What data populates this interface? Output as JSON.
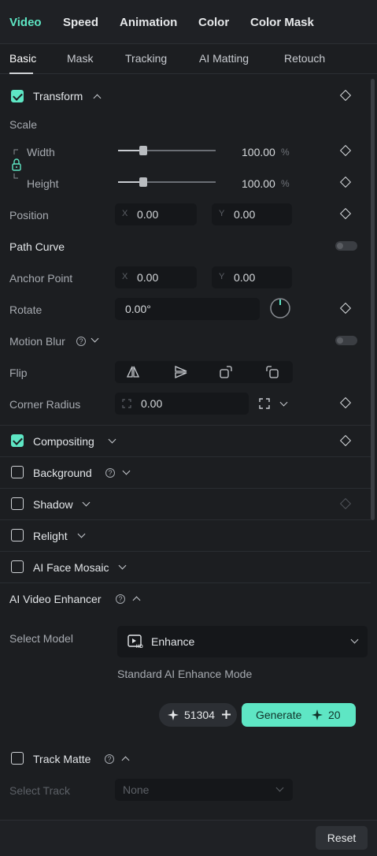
{
  "top_tabs": [
    "Video",
    "Speed",
    "Animation",
    "Color",
    "Color Mask"
  ],
  "sub_tabs": [
    "Basic",
    "Mask",
    "Tracking",
    "AI Matting",
    "Retouch"
  ],
  "transform": {
    "title": "Transform",
    "checked": true,
    "scale_label": "Scale",
    "width_label": "Width",
    "height_label": "Height",
    "width_value": "100.00",
    "height_value": "100.00",
    "width_percent": 0.26,
    "height_percent": 0.26,
    "percent_unit": "%",
    "position_label": "Position",
    "position_x": "0.00",
    "position_y": "0.00",
    "x_prefix": "X",
    "y_prefix": "Y",
    "path_curve_label": "Path Curve",
    "anchor_label": "Anchor Point",
    "anchor_x": "0.00",
    "anchor_y": "0.00",
    "rotate_label": "Rotate",
    "rotate_value": "0.00°",
    "motion_blur_label": "Motion Blur",
    "flip_label": "Flip",
    "corner_radius_label": "Corner Radius",
    "corner_radius_value": "0.00"
  },
  "sections": {
    "compositing": "Compositing",
    "background": "Background",
    "shadow": "Shadow",
    "relight": "Relight",
    "ai_face_mosaic": "AI Face Mosaic"
  },
  "enhancer": {
    "title": "AI Video Enhancer",
    "select_model_label": "Select Model",
    "model_value": "Enhance",
    "model_badge": "HD",
    "mode_description": "Standard AI Enhance Mode",
    "credits": "51304",
    "generate_label": "Generate",
    "generate_cost": "20"
  },
  "track_matte": {
    "title": "Track Matte",
    "select_track_label": "Select Track",
    "select_track_value": "None"
  },
  "footer": {
    "reset_label": "Reset"
  },
  "colors": {
    "accent": "#5ee6c4",
    "background": "#1c1e21"
  },
  "help_glyph": "?"
}
